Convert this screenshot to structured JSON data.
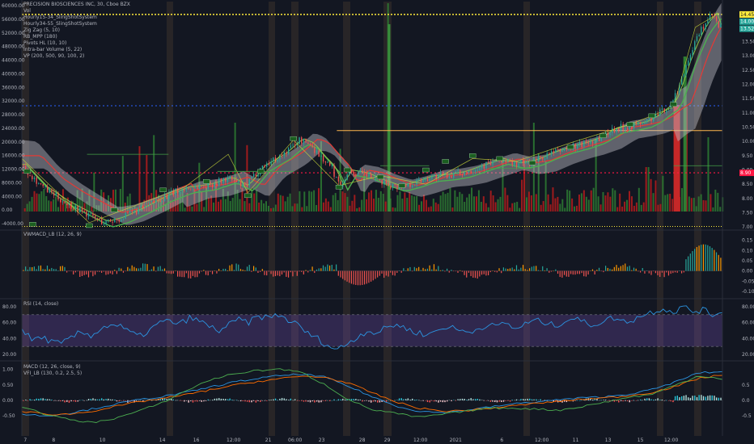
{
  "chart_data": [
    {
      "type": "candlestick",
      "legend": [
        "PRECISION BIOSCIENCES INC, 30, Cboe BZX",
        "Vol",
        "Hourly15-34_SlingShotSystem",
        "Hourly34-55_SlingShotSystem",
        "Zig Zag (5, 10)",
        "RB_MPP (180)",
        "Pivots HL (10, 10)",
        "Intra-bar Volume (5, 22)",
        "VP (200, 500, 90, 100, 2)"
      ],
      "price_axis_labels": [
        "14.00",
        "13.50",
        "13.00",
        "12.50",
        "12.00",
        "11.50",
        "11.00",
        "10.50",
        "10.00",
        "9.50",
        "9.00",
        "8.50",
        "8.00",
        "7.50",
        "7.00"
      ],
      "volume_axis_labels": [
        "60000.00",
        "56000.00",
        "52000.00",
        "48000.00",
        "44000.00",
        "40000.00",
        "36000.00",
        "32000.00",
        "28000.00",
        "24000.00",
        "20000.00",
        "16000.00",
        "12000.00",
        "8000.00",
        "4000.00",
        "0.00",
        "-4000.00"
      ],
      "price_badges": [
        "14.45",
        "14.00",
        "13.52",
        "8.90"
      ],
      "levels": {
        "yellow_dotted": 14.45,
        "red_dotted": 8.9,
        "blue_dotted": 11.25,
        "orange_line": 10.38
      },
      "ylim": [
        6.95,
        14.9
      ],
      "close_path": [
        [
          0,
          9.15
        ],
        [
          20,
          8.35
        ],
        [
          40,
          7.85
        ],
        [
          60,
          7.45
        ],
        [
          75,
          7.15
        ],
        [
          90,
          7.3
        ],
        [
          110,
          7.65
        ],
        [
          130,
          8.05
        ],
        [
          150,
          8.35
        ],
        [
          170,
          8.45
        ],
        [
          190,
          8.7
        ],
        [
          205,
          8.4
        ],
        [
          220,
          9.1
        ],
        [
          240,
          9.55
        ],
        [
          255,
          10.05
        ],
        [
          265,
          9.9
        ],
        [
          275,
          9.45
        ],
        [
          285,
          9.05
        ],
        [
          292,
          8.45
        ],
        [
          300,
          8.95
        ],
        [
          315,
          8.85
        ],
        [
          330,
          8.6
        ],
        [
          345,
          8.4
        ],
        [
          360,
          8.55
        ],
        [
          375,
          8.75
        ],
        [
          390,
          8.8
        ],
        [
          405,
          8.9
        ],
        [
          420,
          9.1
        ],
        [
          440,
          9.35
        ],
        [
          455,
          9.2
        ],
        [
          470,
          9.3
        ],
        [
          485,
          9.55
        ],
        [
          500,
          9.75
        ],
        [
          515,
          9.9
        ],
        [
          530,
          10.1
        ],
        [
          545,
          10.45
        ],
        [
          560,
          10.55
        ],
        [
          572,
          10.65
        ],
        [
          582,
          10.85
        ],
        [
          590,
          11.1
        ],
        [
          598,
          11.3
        ],
        [
          606,
          12.1
        ],
        [
          612,
          12.8
        ],
        [
          618,
          13.35
        ],
        [
          624,
          13.85
        ],
        [
          630,
          14.2
        ],
        [
          636,
          14.45
        ],
        [
          641,
          13.95
        ],
        [
          645,
          14.2
        ]
      ]
    },
    {
      "type": "histogram",
      "title": "VWMACD_LB (12, 26, 9)",
      "axis_labels": [
        "0.15",
        "0.10",
        "0.05",
        "0.00",
        "-0.05",
        "-0.10"
      ],
      "ylim": [
        -0.12,
        0.18
      ]
    },
    {
      "type": "line",
      "title": "RSI (14, close)",
      "axis_labels": [
        "80.00",
        "60.00",
        "40.00",
        "20.00"
      ],
      "band": [
        30,
        70
      ],
      "ylim": [
        15,
        85
      ],
      "series": [
        {
          "name": "RSI",
          "color": "#2b93e0",
          "values": [
            52,
            38,
            42,
            36,
            33,
            41,
            48,
            44,
            52,
            58,
            55,
            47,
            43,
            51,
            60,
            62,
            58,
            66,
            62,
            55,
            50,
            57,
            64,
            60,
            68,
            66,
            70,
            63,
            57,
            46,
            40,
            31,
            26,
            34,
            42,
            50,
            47,
            54,
            58,
            52,
            48,
            44,
            50,
            55,
            52,
            48,
            51,
            57,
            55,
            60,
            52,
            58,
            63,
            60,
            56,
            62,
            66,
            60,
            57,
            63,
            66,
            61,
            64,
            70,
            74,
            78,
            73,
            80,
            74,
            76,
            70,
            74
          ]
        }
      ]
    },
    {
      "type": "line",
      "title": "MACD (12, 26, close, 9)",
      "subtitle": "VFI_LB (130, 0.2, 2.5, 5)",
      "axis_labels": [
        "1.00",
        "0.50",
        "0.00",
        "-0.50"
      ],
      "right_axis_labels": [
        "0.5",
        "0.0",
        "-0.5"
      ],
      "ylim": [
        -1.1,
        1.15
      ],
      "series": [
        {
          "color": "#2b93e0",
          "values": [
            -0.45,
            -0.5,
            -0.42,
            -0.28,
            -0.12,
            0.02,
            0.12,
            0.25,
            0.42,
            0.58,
            0.7,
            0.8,
            0.85,
            0.75,
            0.45,
            0.12,
            -0.18,
            -0.35,
            -0.4,
            -0.32,
            -0.22,
            -0.12,
            -0.05,
            0.02,
            0.08,
            0.12,
            0.2,
            0.35,
            0.6,
            0.9,
            0.92
          ]
        },
        {
          "color": "#ff6d00",
          "values": [
            -0.35,
            -0.45,
            -0.45,
            -0.35,
            -0.2,
            -0.05,
            0.06,
            0.18,
            0.33,
            0.48,
            0.6,
            0.7,
            0.78,
            0.75,
            0.55,
            0.25,
            -0.05,
            -0.25,
            -0.35,
            -0.33,
            -0.26,
            -0.18,
            -0.1,
            -0.03,
            0.04,
            0.08,
            0.15,
            0.26,
            0.45,
            0.72,
            0.82
          ]
        },
        {
          "color": "#4caf50",
          "values": [
            -0.2,
            -0.45,
            -0.62,
            -0.72,
            -0.58,
            -0.35,
            -0.08,
            0.3,
            0.65,
            0.85,
            0.96,
            1.02,
            0.9,
            0.5,
            0.02,
            -0.3,
            -0.42,
            -0.55,
            -0.45,
            -0.35,
            -0.25,
            -0.25,
            -0.28,
            -0.32,
            -0.2,
            -0.05,
            0.1,
            0.2,
            0.5,
            0.8,
            0.7
          ]
        }
      ]
    },
    {
      "type": "time_axis",
      "labels": [
        "7",
        "8",
        "10",
        "14",
        "16",
        "12:00",
        "21",
        "06:00",
        "23",
        "28",
        "29",
        "12:00",
        "2021",
        "6",
        "12:00",
        "11",
        "13",
        "15",
        "12:00"
      ]
    }
  ]
}
